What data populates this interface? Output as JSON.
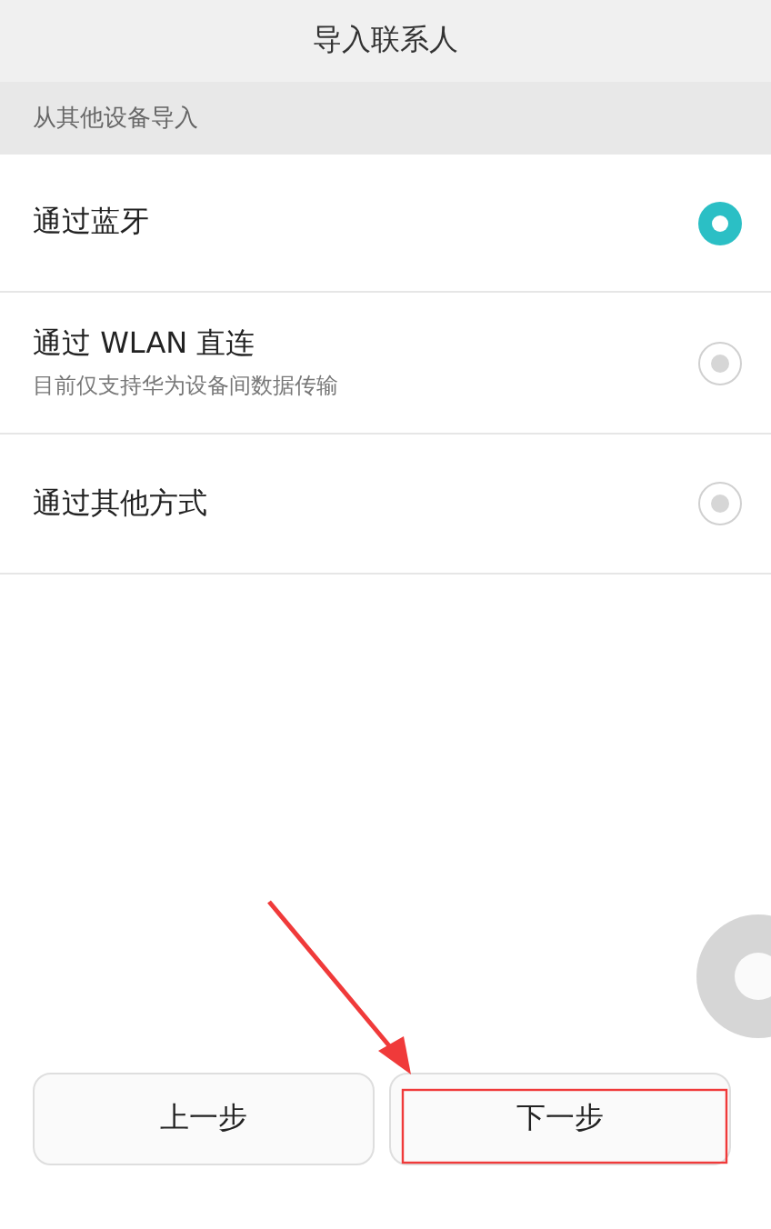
{
  "title": "导入联系人",
  "section": "从其他设备导入",
  "options": [
    {
      "label": "通过蓝牙",
      "selected": true
    },
    {
      "label": "通过 WLAN 直连",
      "subtitle": "目前仅支持华为设备间数据传输",
      "selected": false
    },
    {
      "label": "通过其他方式",
      "selected": false
    }
  ],
  "buttons": [
    "上一步",
    "下一步"
  ]
}
